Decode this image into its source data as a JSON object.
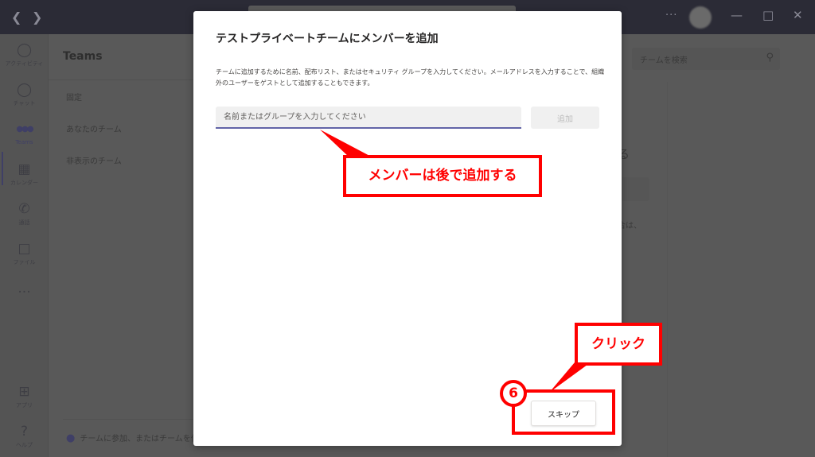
{
  "titlebar": {
    "back_icon": "chevron-left-icon",
    "forward_icon": "chevron-right-icon",
    "more_label": "···",
    "minimize": "—",
    "maximize": "□",
    "close": "✕"
  },
  "rail": {
    "items": [
      {
        "label": "アクティビティ",
        "icon": "bell-icon",
        "glyph": "🔔"
      },
      {
        "label": "チャット",
        "icon": "chat-icon",
        "glyph": "💬"
      },
      {
        "label": "Teams",
        "icon": "teams-icon",
        "glyph": "●●●"
      },
      {
        "label": "カレンダー",
        "icon": "calendar-icon",
        "glyph": "📅"
      },
      {
        "label": "通話",
        "icon": "phone-icon",
        "glyph": "✆"
      },
      {
        "label": "ファイル",
        "icon": "file-icon",
        "glyph": "🗎"
      },
      {
        "label": "",
        "icon": "more-icon",
        "glyph": "···"
      },
      {
        "label": "アプリ",
        "icon": "apps-icon",
        "glyph": "⊞"
      },
      {
        "label": "ヘルプ",
        "icon": "help-icon",
        "glyph": "?"
      }
    ]
  },
  "teams_pane": {
    "title": "Teams",
    "items": [
      "固定",
      "あなたのチーム",
      "非表示のチーム"
    ],
    "join_label": "チームに参加、またはチームを作成"
  },
  "main": {
    "search_placeholder": "チームを検索",
    "bg_fragment_1": "る",
    "bg_fragment_2": "場合は、"
  },
  "modal": {
    "title": "テストプライベートチームにメンバーを追加",
    "description": "チームに追加するために名前、配布リスト、またはセキュリティ グループを入力してください。メールアドレスを入力することで、組織外のユーザーをゲストとして追加することもできます。",
    "input_placeholder": "名前またはグループを入力してください",
    "input_value": "",
    "add_button": "追加",
    "skip_button": "スキップ"
  },
  "annotations": {
    "callout_later": "メンバーは後で追加する",
    "callout_click": "クリック",
    "step_number": "6",
    "color": "#ff0000"
  },
  "colors": {
    "accent": "#6264a7",
    "titlebar": "#2b2b36",
    "overlay_bg": "#595959",
    "annotation_red": "#ff0000"
  }
}
